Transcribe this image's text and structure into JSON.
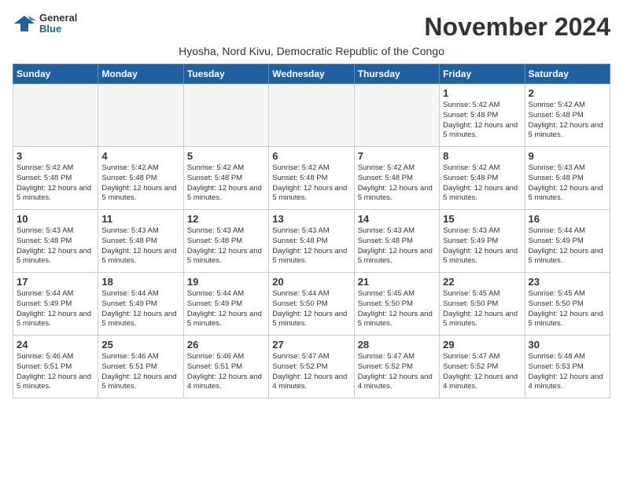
{
  "logo": {
    "line1": "General",
    "line2": "Blue"
  },
  "title": "November 2024",
  "subtitle": "Hyosha, Nord Kivu, Democratic Republic of the Congo",
  "weekdays": [
    "Sunday",
    "Monday",
    "Tuesday",
    "Wednesday",
    "Thursday",
    "Friday",
    "Saturday"
  ],
  "weeks": [
    [
      {
        "day": "",
        "info": "",
        "empty": true
      },
      {
        "day": "",
        "info": "",
        "empty": true
      },
      {
        "day": "",
        "info": "",
        "empty": true
      },
      {
        "day": "",
        "info": "",
        "empty": true
      },
      {
        "day": "",
        "info": "",
        "empty": true
      },
      {
        "day": "1",
        "info": "Sunrise: 5:42 AM\nSunset: 5:48 PM\nDaylight: 12 hours and 5 minutes."
      },
      {
        "day": "2",
        "info": "Sunrise: 5:42 AM\nSunset: 5:48 PM\nDaylight: 12 hours and 5 minutes."
      }
    ],
    [
      {
        "day": "3",
        "info": "Sunrise: 5:42 AM\nSunset: 5:48 PM\nDaylight: 12 hours and 5 minutes."
      },
      {
        "day": "4",
        "info": "Sunrise: 5:42 AM\nSunset: 5:48 PM\nDaylight: 12 hours and 5 minutes."
      },
      {
        "day": "5",
        "info": "Sunrise: 5:42 AM\nSunset: 5:48 PM\nDaylight: 12 hours and 5 minutes."
      },
      {
        "day": "6",
        "info": "Sunrise: 5:42 AM\nSunset: 5:48 PM\nDaylight: 12 hours and 5 minutes."
      },
      {
        "day": "7",
        "info": "Sunrise: 5:42 AM\nSunset: 5:48 PM\nDaylight: 12 hours and 5 minutes."
      },
      {
        "day": "8",
        "info": "Sunrise: 5:42 AM\nSunset: 5:48 PM\nDaylight: 12 hours and 5 minutes."
      },
      {
        "day": "9",
        "info": "Sunrise: 5:43 AM\nSunset: 5:48 PM\nDaylight: 12 hours and 5 minutes."
      }
    ],
    [
      {
        "day": "10",
        "info": "Sunrise: 5:43 AM\nSunset: 5:48 PM\nDaylight: 12 hours and 5 minutes."
      },
      {
        "day": "11",
        "info": "Sunrise: 5:43 AM\nSunset: 5:48 PM\nDaylight: 12 hours and 5 minutes."
      },
      {
        "day": "12",
        "info": "Sunrise: 5:43 AM\nSunset: 5:48 PM\nDaylight: 12 hours and 5 minutes."
      },
      {
        "day": "13",
        "info": "Sunrise: 5:43 AM\nSunset: 5:48 PM\nDaylight: 12 hours and 5 minutes."
      },
      {
        "day": "14",
        "info": "Sunrise: 5:43 AM\nSunset: 5:48 PM\nDaylight: 12 hours and 5 minutes."
      },
      {
        "day": "15",
        "info": "Sunrise: 5:43 AM\nSunset: 5:49 PM\nDaylight: 12 hours and 5 minutes."
      },
      {
        "day": "16",
        "info": "Sunrise: 5:44 AM\nSunset: 5:49 PM\nDaylight: 12 hours and 5 minutes."
      }
    ],
    [
      {
        "day": "17",
        "info": "Sunrise: 5:44 AM\nSunset: 5:49 PM\nDaylight: 12 hours and 5 minutes."
      },
      {
        "day": "18",
        "info": "Sunrise: 5:44 AM\nSunset: 5:49 PM\nDaylight: 12 hours and 5 minutes."
      },
      {
        "day": "19",
        "info": "Sunrise: 5:44 AM\nSunset: 5:49 PM\nDaylight: 12 hours and 5 minutes."
      },
      {
        "day": "20",
        "info": "Sunrise: 5:44 AM\nSunset: 5:50 PM\nDaylight: 12 hours and 5 minutes."
      },
      {
        "day": "21",
        "info": "Sunrise: 5:45 AM\nSunset: 5:50 PM\nDaylight: 12 hours and 5 minutes."
      },
      {
        "day": "22",
        "info": "Sunrise: 5:45 AM\nSunset: 5:50 PM\nDaylight: 12 hours and 5 minutes."
      },
      {
        "day": "23",
        "info": "Sunrise: 5:45 AM\nSunset: 5:50 PM\nDaylight: 12 hours and 5 minutes."
      }
    ],
    [
      {
        "day": "24",
        "info": "Sunrise: 5:46 AM\nSunset: 5:51 PM\nDaylight: 12 hours and 5 minutes."
      },
      {
        "day": "25",
        "info": "Sunrise: 5:46 AM\nSunset: 5:51 PM\nDaylight: 12 hours and 5 minutes."
      },
      {
        "day": "26",
        "info": "Sunrise: 5:46 AM\nSunset: 5:51 PM\nDaylight: 12 hours and 4 minutes."
      },
      {
        "day": "27",
        "info": "Sunrise: 5:47 AM\nSunset: 5:52 PM\nDaylight: 12 hours and 4 minutes."
      },
      {
        "day": "28",
        "info": "Sunrise: 5:47 AM\nSunset: 5:52 PM\nDaylight: 12 hours and 4 minutes."
      },
      {
        "day": "29",
        "info": "Sunrise: 5:47 AM\nSunset: 5:52 PM\nDaylight: 12 hours and 4 minutes."
      },
      {
        "day": "30",
        "info": "Sunrise: 5:48 AM\nSunset: 5:53 PM\nDaylight: 12 hours and 4 minutes."
      }
    ]
  ]
}
